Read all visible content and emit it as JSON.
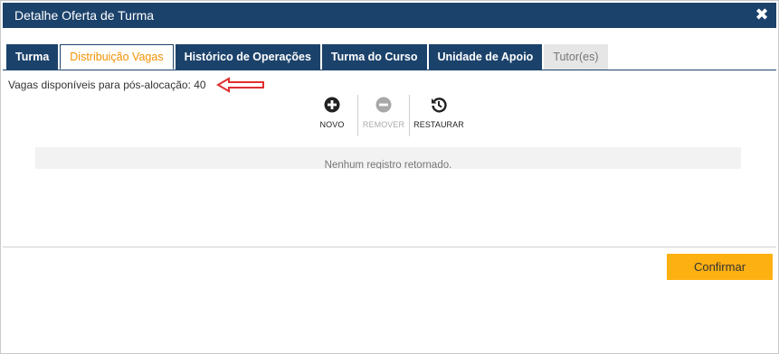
{
  "dialog": {
    "title": "Detalhe Oferta de Turma",
    "close_symbol": "✖"
  },
  "tabs": [
    {
      "label": "Turma"
    },
    {
      "label": "Distribuição Vagas"
    },
    {
      "label": "Histórico de Operações"
    },
    {
      "label": "Turma do Curso"
    },
    {
      "label": "Unidade de Apoio"
    },
    {
      "label": "Tutor(es)"
    }
  ],
  "active_tab": "Distribuição Vagas",
  "vagas": {
    "text": "Vagas disponíveis para pós-alocação: 40"
  },
  "toolbar": {
    "novo_label": "NOVO",
    "remover_label": "REMOVER",
    "restaurar_label": "RESTAURAR"
  },
  "grid": {
    "empty_message": "Nenhum registro retornado."
  },
  "footer": {
    "confirm_label": "Confirmar"
  },
  "colors": {
    "header_bg": "#1b426b",
    "active_tab_text": "#f39200",
    "confirm_bg": "#fdb012",
    "annotation_arrow": "#e03030"
  },
  "icons": {
    "close": "close-icon",
    "novo": "plus-circle-icon",
    "remover": "minus-circle-icon",
    "restaurar": "history-icon",
    "annotation": "arrow-left-icon"
  }
}
